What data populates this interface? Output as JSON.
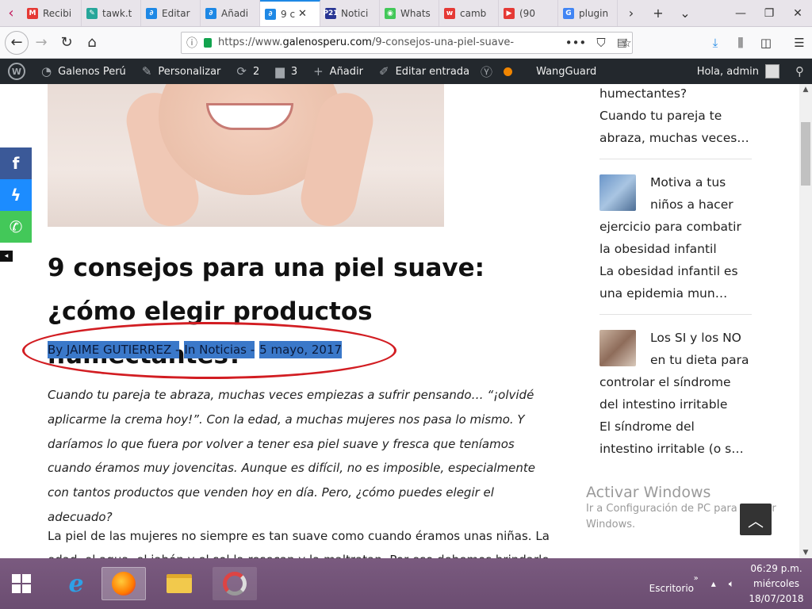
{
  "browser": {
    "tabs": [
      {
        "label": "Recibi",
        "fav_color": "#e53935",
        "fav": "M"
      },
      {
        "label": "tawk.t",
        "fav_color": "#26a69a",
        "fav": "✎"
      },
      {
        "label": "Editar",
        "fav_color": "#1e88e5",
        "fav": "∂"
      },
      {
        "label": "Añadi",
        "fav_color": "#1e88e5",
        "fav": "∂"
      },
      {
        "label": "9 c",
        "fav_color": "#1e88e5",
        "fav": "∂",
        "active": true
      },
      {
        "label": "Notici",
        "fav_color": "#283593",
        "fav": "P21"
      },
      {
        "label": "Whats",
        "fav_color": "#43c859",
        "fav": "◉"
      },
      {
        "label": "camb",
        "fav_color": "#e53935",
        "fav": "w"
      },
      {
        "label": "(90",
        "fav_color": "#e53935",
        "fav": "▶"
      },
      {
        "label": "plugin",
        "fav_color": "#4285f4",
        "fav": "G"
      }
    ],
    "url_prefix": "https://www.",
    "url_domain": "galenosperu.com",
    "url_path": "/9-consejos-una-piel-suave-"
  },
  "wpbar": {
    "site": "Galenos Perú",
    "customize": "Personalizar",
    "updates": "2",
    "comments": "3",
    "add": "Añadir",
    "edit": "Editar entrada",
    "wangguard": "WangGuard",
    "greeting": "Hola, admin"
  },
  "share": {
    "fb": "f",
    "messenger": "ϟ",
    "whatsapp": "✆"
  },
  "post": {
    "title": "9 consejos para una piel suave: ¿cómo elegir productos humectantes?",
    "meta_author": "By JAIME GUTIERREZ -",
    "meta_category": "In Noticias -",
    "meta_date": "5 mayo, 2017",
    "intro": "Cuando tu pareja te abraza, muchas veces empiezas a sufrir pensando… “¡olvidé aplicarme la crema hoy!”. Con la edad, a muchas mujeres nos pasa lo mismo. Y daríamos lo que fuera por volver a tener esa piel suave y fresca que teníamos cuando éramos muy jovencitas. Aunque es difícil, no es imposible, especialmente con tantos productos que venden hoy en día. Pero, ¿cómo puedes elegir el adecuado?",
    "paragraph": "La piel de las mujeres no siempre es tan suave como cuando éramos unas niñas. La edad, el agua, el jabón y el sol la resecan y la maltratan. Por eso debemos brindarle"
  },
  "sidebar": {
    "top_title_tail": "humectantes?",
    "top_excerpt": "Cuando tu pareja te abraza, muchas veces…",
    "items": [
      {
        "title": "Motiva a tus niños a hacer ejercicio para combatir la obesidad infantil",
        "excerpt": "La obesidad infantil es una epidemia mun…"
      },
      {
        "title": "Los SI y los NO en tu dieta para controlar el síndrome del intestino irritable",
        "excerpt": "El síndrome del intestino irritable (o s…"
      }
    ]
  },
  "watermark": {
    "title": "Activar Windows",
    "subtitle": "Ir a Configuración de PC para activar Windows."
  },
  "taskbar": {
    "desktop": "Escritorio",
    "time": "06:29 p.m.",
    "day": "miércoles",
    "date": "18/07/2018"
  }
}
